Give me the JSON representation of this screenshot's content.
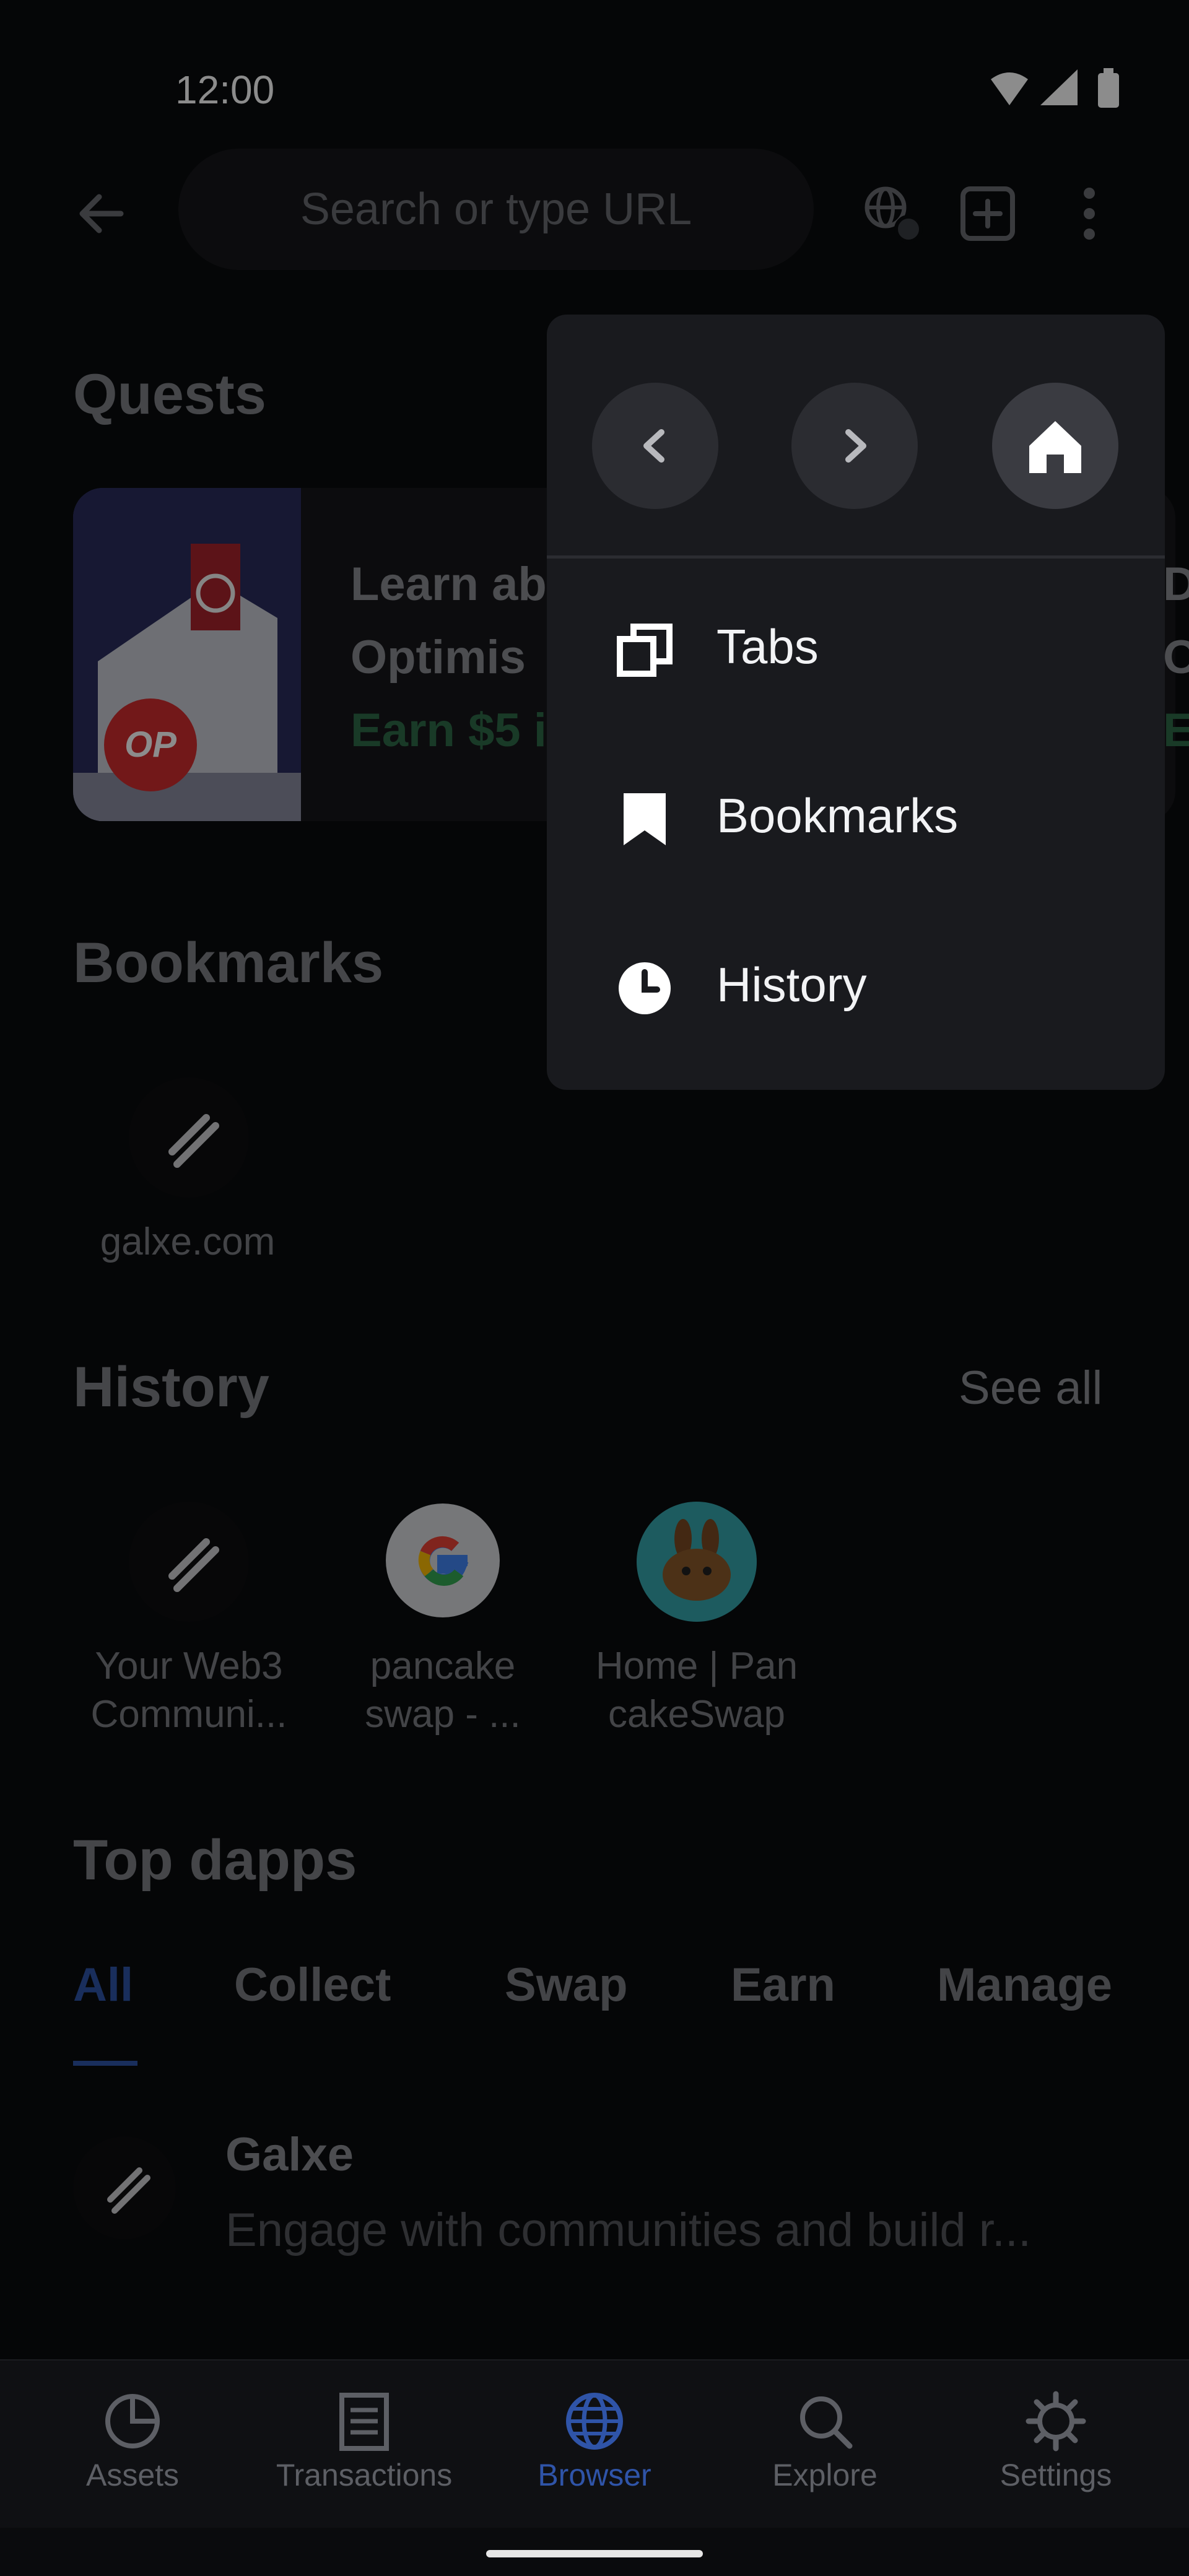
{
  "status_bar": {
    "time": "12:00"
  },
  "search": {
    "placeholder": "Search or type URL"
  },
  "quests": {
    "title": "Quests",
    "card": {
      "line1": "Learn ab",
      "line2": "Optimis",
      "earn": "Earn $5 i",
      "badge": "OP"
    },
    "peek": {
      "line1": "D",
      "line2": "O",
      "line3": "E"
    }
  },
  "bookmarks": {
    "title": "Bookmarks",
    "items": [
      {
        "label": "galxe.com",
        "icon": "galxe-icon"
      }
    ]
  },
  "history": {
    "title": "History",
    "see_all": "See all",
    "items": [
      {
        "line1": "Your Web3",
        "line2": "Communi...",
        "icon": "galxe-icon"
      },
      {
        "line1": "pancake",
        "line2": "swap - ...",
        "icon": "google-icon"
      },
      {
        "line1": "Home | Pan",
        "line2": "cakeSwap",
        "icon": "pancakeswap-icon"
      }
    ]
  },
  "top_dapps": {
    "title": "Top dapps",
    "tabs": [
      "All",
      "Collect",
      "Swap",
      "Earn",
      "Manage"
    ],
    "active_tab": "All",
    "list": [
      {
        "name": "Galxe",
        "description": "Engage with communities and build r..."
      }
    ]
  },
  "menu": {
    "nav": {
      "back": "chevron-left-icon",
      "forward": "chevron-right-icon",
      "home": "home-icon"
    },
    "items": [
      {
        "label": "Tabs",
        "icon": "tabs-icon"
      },
      {
        "label": "Bookmarks",
        "icon": "bookmark-icon"
      },
      {
        "label": "History",
        "icon": "clock-icon"
      }
    ]
  },
  "bottom_nav": {
    "items": [
      {
        "label": "Assets",
        "icon": "pie-chart-icon"
      },
      {
        "label": "Transactions",
        "icon": "receipt-icon"
      },
      {
        "label": "Browser",
        "icon": "globe-icon"
      },
      {
        "label": "Explore",
        "icon": "search-icon"
      },
      {
        "label": "Settings",
        "icon": "gear-icon"
      }
    ],
    "active": "Browser"
  },
  "colors": {
    "background": "#0a0b0d",
    "accent": "#2f54a8",
    "menu_bg": "#191a1e",
    "earn_green": "#2f6b48"
  }
}
